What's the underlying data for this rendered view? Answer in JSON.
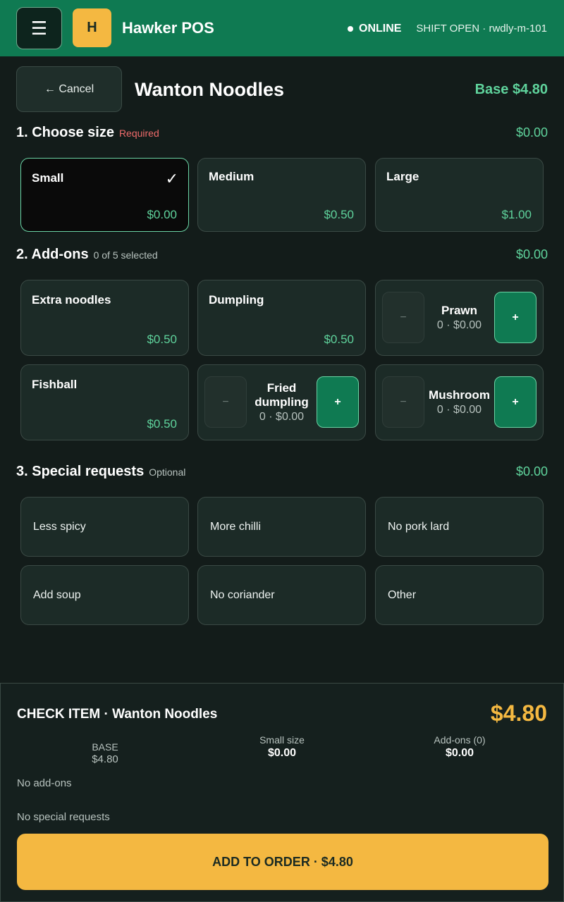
{
  "topbar": {
    "menu_icon": "☰",
    "logo_letter": "H",
    "app_title": "Hawker POS",
    "status": "ONLINE",
    "shift": "SHIFT OPEN · rwdly-m-101"
  },
  "header": {
    "cancel_label": "← Cancel",
    "item_name": "Wanton Noodles",
    "base_price": "Base $4.80"
  },
  "sections": {
    "size": {
      "title": "1. Choose size",
      "note": "Required",
      "amount": "$0.00"
    },
    "addons": {
      "title": "2. Add-ons",
      "note": "0 of 5 selected",
      "amount": "$0.00"
    },
    "requests": {
      "title": "3. Special requests",
      "note": "Optional",
      "amount": "$0.00"
    }
  },
  "sizes": [
    {
      "name": "Small",
      "price": "$0.00",
      "selected": true,
      "check": "✓"
    },
    {
      "name": "Medium",
      "price": "$0.50",
      "selected": false
    },
    {
      "name": "Large",
      "price": "$1.00",
      "selected": false
    }
  ],
  "addons": [
    {
      "name": "Extra noodles",
      "price": "$0.50"
    },
    {
      "name": "Dumpling",
      "price": "$0.50"
    },
    {
      "name": "Prawn",
      "meta": "0  ·  $0.00",
      "minus": "−",
      "plus": "+"
    },
    {
      "name": "Fishball",
      "price": "$0.50"
    },
    {
      "name": "Fried dumpling",
      "meta": "0  ·  $0.00",
      "minus": "−",
      "plus": "+"
    },
    {
      "name": "Mushroom",
      "meta": "0  ·  $0.00",
      "minus": "−",
      "plus": "+"
    }
  ],
  "requests": [
    "Less spicy",
    "More chilli",
    "No pork lard",
    "Add soup",
    "No coriander",
    "Other"
  ],
  "summary": {
    "title": "CHECK ITEM  ·  Wanton Noodles",
    "total": "$4.80",
    "base_label": "BASE",
    "base_value": "$4.80",
    "size_label": "Small size",
    "size_value": "$0.00",
    "addons_label": "Add-ons (0)",
    "addons_value": "$0.00",
    "addons_line": "No add-ons",
    "requests_line": "No special requests",
    "add_button": "ADD TO ORDER  ·  $4.80"
  },
  "colors": {
    "brand_green": "#0f7a52",
    "accent_green": "#5fd39c",
    "accent_yellow": "#f4b841",
    "required_red": "#ef6b6b"
  }
}
